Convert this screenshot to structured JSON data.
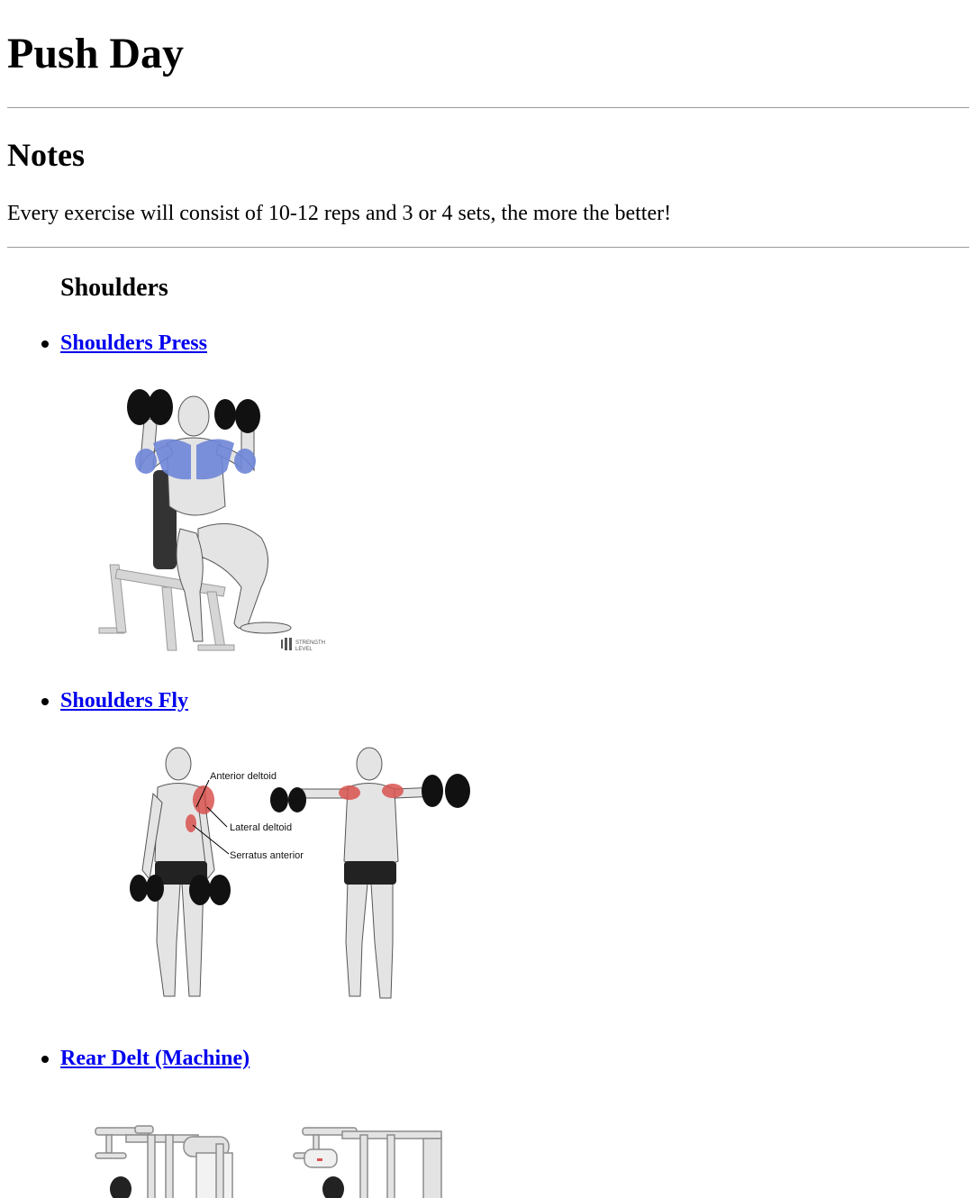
{
  "page": {
    "title": "Push Day",
    "notes_heading": "Notes",
    "notes_text": "Every exercise will consist of 10-12 reps and 3 or 4 sets, the more the better!"
  },
  "section": {
    "heading": "Shoulders",
    "exercises": [
      {
        "label": "Shoulders Press"
      },
      {
        "label": "Shoulders Fly",
        "figure_labels": [
          "Anterior deltoid",
          "Lateral deltoid",
          "Serratus anterior"
        ]
      },
      {
        "label": "Rear Delt (Machine)"
      }
    ]
  },
  "watermark": {
    "line1": "STRENGTH",
    "line2": "LEVEL"
  },
  "colors": {
    "link": "#0000ee",
    "rule": "#9a9a9a",
    "muscle_blue": "#6f86d8",
    "muscle_red": "#d9534f"
  }
}
